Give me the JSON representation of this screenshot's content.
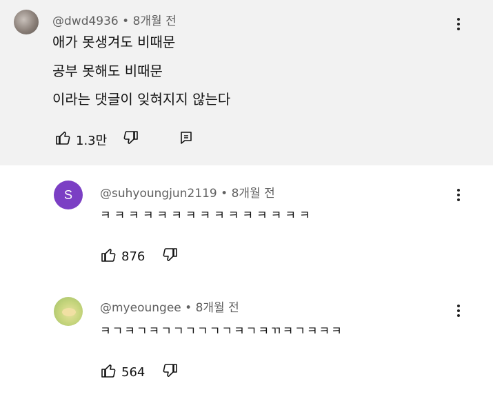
{
  "comments": [
    {
      "author": "@dwd4936",
      "time": "• 8개월 전",
      "lines": [
        "애가 못생겨도 비때문",
        "공부 못해도 비때문",
        "이라는 댓글이 잊혀지지 않는다"
      ],
      "likes": "1.3만"
    },
    {
      "avatar_letter": "S",
      "author": "@suhyoungjun2119",
      "time": "• 8개월 전",
      "text": "ㅋㅋㅋㅋㅋㅋㅋㅋㅋㅋㅋㅋㅋㅋㅋ",
      "likes": "876"
    },
    {
      "author": "@myeoungee",
      "time": "• 8개월 전",
      "text": "ㅋㄱㅋㄱㅋㄱㄱㄱㄱㄱㄱㅋㄱㅋㄲㅋㄱㅋㅋㅋ",
      "likes": "564"
    }
  ],
  "icons": [
    "thumbs-up-icon",
    "thumbs-down-icon",
    "reply-icon",
    "more-vert-icon"
  ],
  "colors": {
    "main_bg": "#f2f2f2",
    "avatar_s": "#7b3fc4",
    "meta": "#606060"
  }
}
